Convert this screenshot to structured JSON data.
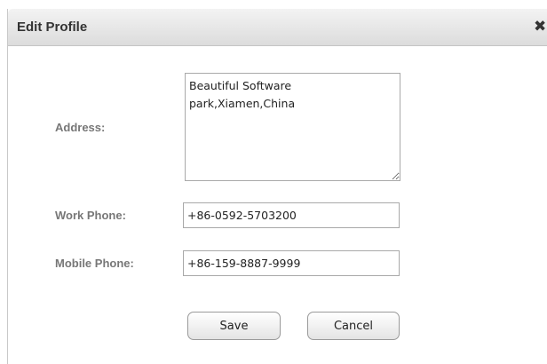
{
  "dialog": {
    "title": "Edit Profile",
    "close_icon": "close-icon"
  },
  "form": {
    "address": {
      "label": "Address:",
      "value": "Beautiful Software park,Xiamen,China"
    },
    "work_phone": {
      "label": "Work Phone:",
      "value": "+86-0592-5703200"
    },
    "mobile_phone": {
      "label": "Mobile Phone:",
      "value": "+86-159-8887-9999"
    }
  },
  "actions": {
    "save_label": "Save",
    "cancel_label": "Cancel"
  }
}
